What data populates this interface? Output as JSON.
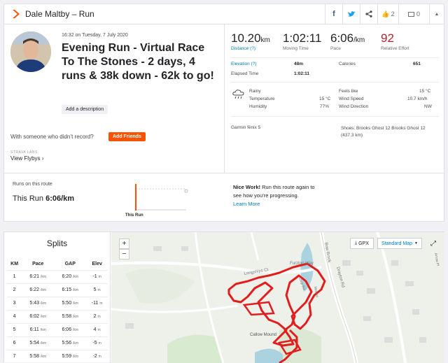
{
  "header": {
    "title": "Dale Maltby – Run",
    "kudos_count": "2",
    "comment_count": "0"
  },
  "activity": {
    "datetime": "16:32 on Tuesday, 7 July 2020",
    "title": "Evening Run - Virtual Race To The Stones - 2 days, 4 runs & 38k down - 62k to go!",
    "add_description": "Add a description",
    "with_someone": "With someone who didn’t record?",
    "add_friends": "Add Friends",
    "labs_label": "STRAVA LABS",
    "view_flybys": "View Flybys"
  },
  "stats": {
    "distance": {
      "value": "10.20",
      "unit": "km",
      "label": "Distance"
    },
    "moving_time": {
      "value": "1:02:11",
      "label": "Moving Time"
    },
    "pace": {
      "value": "6:06",
      "unit": "/km",
      "label": "Pace"
    },
    "relative_effort": {
      "value": "92",
      "label": "Relative Effort"
    },
    "elevation_label": "Elevation",
    "elevation": "48m",
    "calories_label": "Calories",
    "calories": "651",
    "elapsed_label": "Elapsed Time",
    "elapsed": "1:02:11",
    "weather": {
      "condition": "Rainy",
      "temp_label": "Temperature",
      "temp": "15 °C",
      "humidity_label": "Humidity",
      "humidity": "77%",
      "feels_label": "Feels like",
      "feels": "15 °C",
      "wind_speed_label": "Wind Speed",
      "wind_speed": "10.7 km/h",
      "wind_dir_label": "Wind Direction",
      "wind_dir": "NW"
    },
    "device": "Garmin fēnix 5",
    "shoes": "Shoes: Brooks Ghost 12 Brooks Ghost 12 (437.3 km)"
  },
  "route": {
    "runs_label": "Runs on this route",
    "this_run_prefix": "This Run",
    "this_run_pace": "6:06/km",
    "bar_label": "This Run",
    "nice_work": "Nice Work!",
    "nice_text": "Run this route again to see how you’re progressing.",
    "learn_more": "Learn More"
  },
  "splits": {
    "title": "Splits",
    "headers": [
      "KM",
      "Pace",
      "GAP",
      "Elev"
    ],
    "rows": [
      {
        "km": "1",
        "pace": "6:21",
        "gap": "6:20",
        "elev": "-1"
      },
      {
        "km": "2",
        "pace": "6:22",
        "gap": "6:15",
        "elev": "5"
      },
      {
        "km": "3",
        "pace": "5:43",
        "gap": "5:50",
        "elev": "-11"
      },
      {
        "km": "4",
        "pace": "6:02",
        "gap": "5:58",
        "elev": "2"
      },
      {
        "km": "5",
        "pace": "6:11",
        "gap": "6:06",
        "elev": "4"
      },
      {
        "km": "6",
        "pace": "5:54",
        "gap": "5:56",
        "elev": "-5"
      },
      {
        "km": "7",
        "pace": "5:58",
        "gap": "5:59",
        "elev": "-2"
      }
    ],
    "pace_unit": "/km",
    "elev_unit": "m"
  },
  "map": {
    "gpx": "GPX",
    "map_type": "Standard Map",
    "labels": {
      "brook": "Bow Brook",
      "road": "Drayton Rd",
      "furzton": "Furzton Way",
      "longships": "Longships Ct",
      "callow": "Callow Mound",
      "arrow": "Arrow Pl",
      "loop": "Loop Rd",
      "mound": "Mound"
    },
    "zoom_in": "+",
    "zoom_out": "−"
  },
  "colors": {
    "accent": "#fc5200",
    "link": "#007fb6",
    "route": "#e11d1d",
    "effort": "#b3232f"
  }
}
